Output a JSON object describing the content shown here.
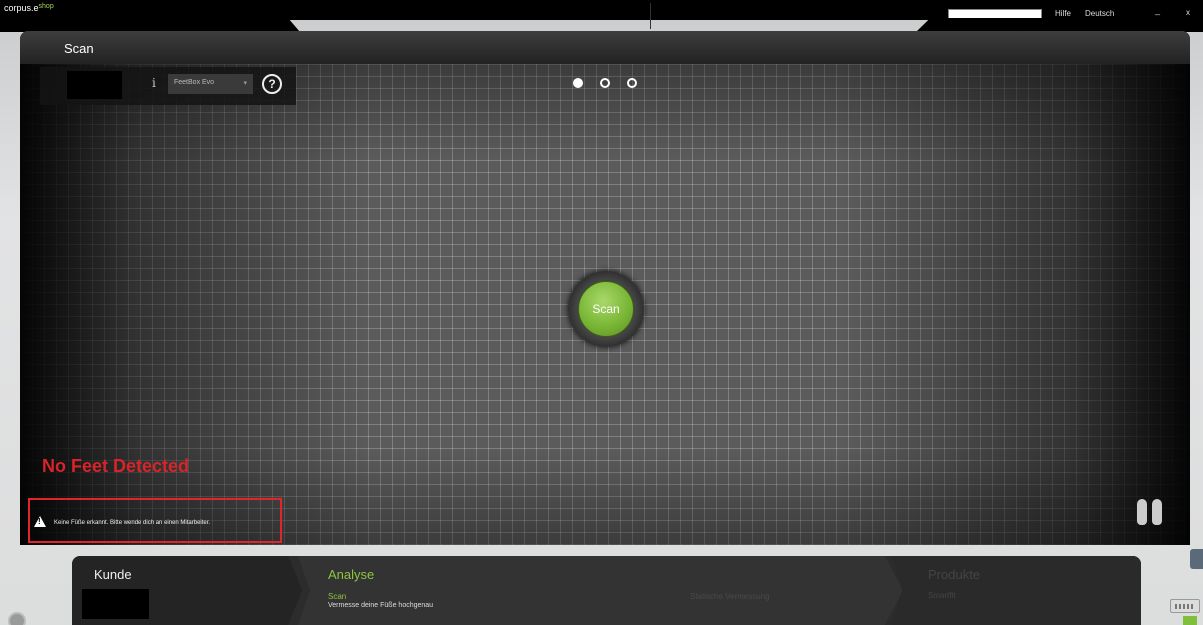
{
  "topbar": {
    "brand": "corpus.e",
    "brand_suffix": "shop",
    "help_label": "Hilfe",
    "language_label": "Deutsch",
    "minimize_label": "_",
    "close_label": "x"
  },
  "main": {
    "title": "Scan",
    "device_select": {
      "value": "FeetBox Evo",
      "arrow": "▾"
    },
    "info_icon": "i",
    "help_icon": "?",
    "steps_total": 3,
    "steps_active": 1,
    "scan_button_label": "Scan",
    "status_heading": "No Feet Detected",
    "warning_message": "Keine Füße erkannt. Bitte wende dich an einen Mitarbeiter.",
    "colors": {
      "accent_green": "#8cc63f",
      "error_red": "#d6252a"
    }
  },
  "wizard": {
    "step1": {
      "title": "Kunde"
    },
    "step2": {
      "title": "Analyse",
      "active_sub": "Scan",
      "active_desc": "Vermesse deine Füße hochgenau",
      "next_sub": "Statische Vermessung"
    },
    "step3": {
      "title": "Produkte",
      "sub": "Smartfit"
    }
  }
}
